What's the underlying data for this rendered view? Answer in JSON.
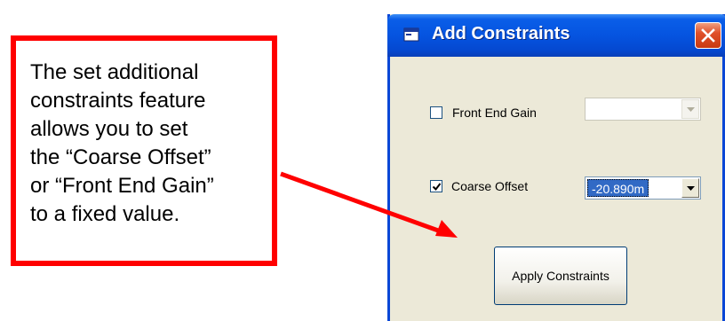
{
  "callout": {
    "lines": [
      "The set additional",
      "constraints feature",
      "allows you to set",
      "the “Coarse Offset”",
      "or “Front End Gain”",
      "to a fixed value."
    ]
  },
  "dialog": {
    "title": "Add Constraints",
    "front_end_gain": {
      "label": "Front End Gain",
      "checked": false,
      "value": "",
      "enabled": false
    },
    "coarse_offset": {
      "label": "Coarse Offset",
      "checked": true,
      "value": "-20.890m",
      "enabled": true
    },
    "apply_label": "Apply Constraints"
  },
  "colors": {
    "callout_border": "#ff0000",
    "arrow": "#ff0000",
    "titlebar": "#0554e0",
    "dialog_bg": "#ece9d8",
    "close_button": "#e0502a"
  },
  "icons": [
    "window-app-icon",
    "close-icon",
    "checkmark-icon",
    "chevron-down-icon",
    "arrow"
  ]
}
